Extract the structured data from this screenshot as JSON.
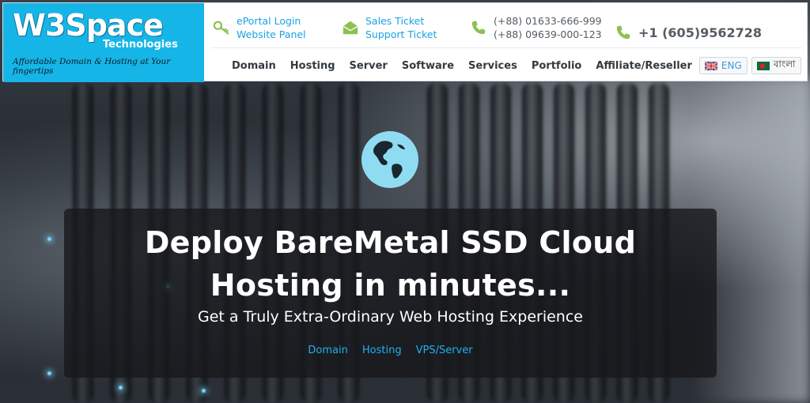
{
  "brand": {
    "name": "W3Space",
    "sub": "Technologies",
    "tagline": "Affordable Domain & Hosting at Your fingertips",
    "accent": "#16b5e8"
  },
  "contacts": [
    {
      "icon": "key-icon",
      "lines": [
        "ePortal Login",
        "Website Panel"
      ]
    },
    {
      "icon": "envelope-icon",
      "lines": [
        "Sales Ticket",
        "Support Ticket"
      ]
    },
    {
      "icon": "phone-icon",
      "lines": [
        "(+88) 01633-666-999",
        "(+88) 09639-000-123"
      ]
    },
    {
      "icon": "phone-icon",
      "lines": [
        "+1 (605)9562728"
      ]
    }
  ],
  "nav": [
    "Domain",
    "Hosting",
    "Server",
    "Software",
    "Services",
    "Portfolio",
    "Affiliate/Reseller"
  ],
  "languages": [
    {
      "label": "ENG",
      "flag": "uk-flag-icon"
    },
    {
      "label": "বাংলা",
      "flag": "bangladesh-flag-icon"
    }
  ],
  "hero": {
    "icon": "globe-icon",
    "title_line1": "Deploy BareMetal SSD Cloud",
    "title_line2": "Hosting in minutes...",
    "subtitle": "Get a Truly Extra-Ordinary Web Hosting Experience",
    "links": [
      "Domain",
      "Hosting",
      "VPS/Server"
    ],
    "link_color": "#1fb1f0"
  }
}
